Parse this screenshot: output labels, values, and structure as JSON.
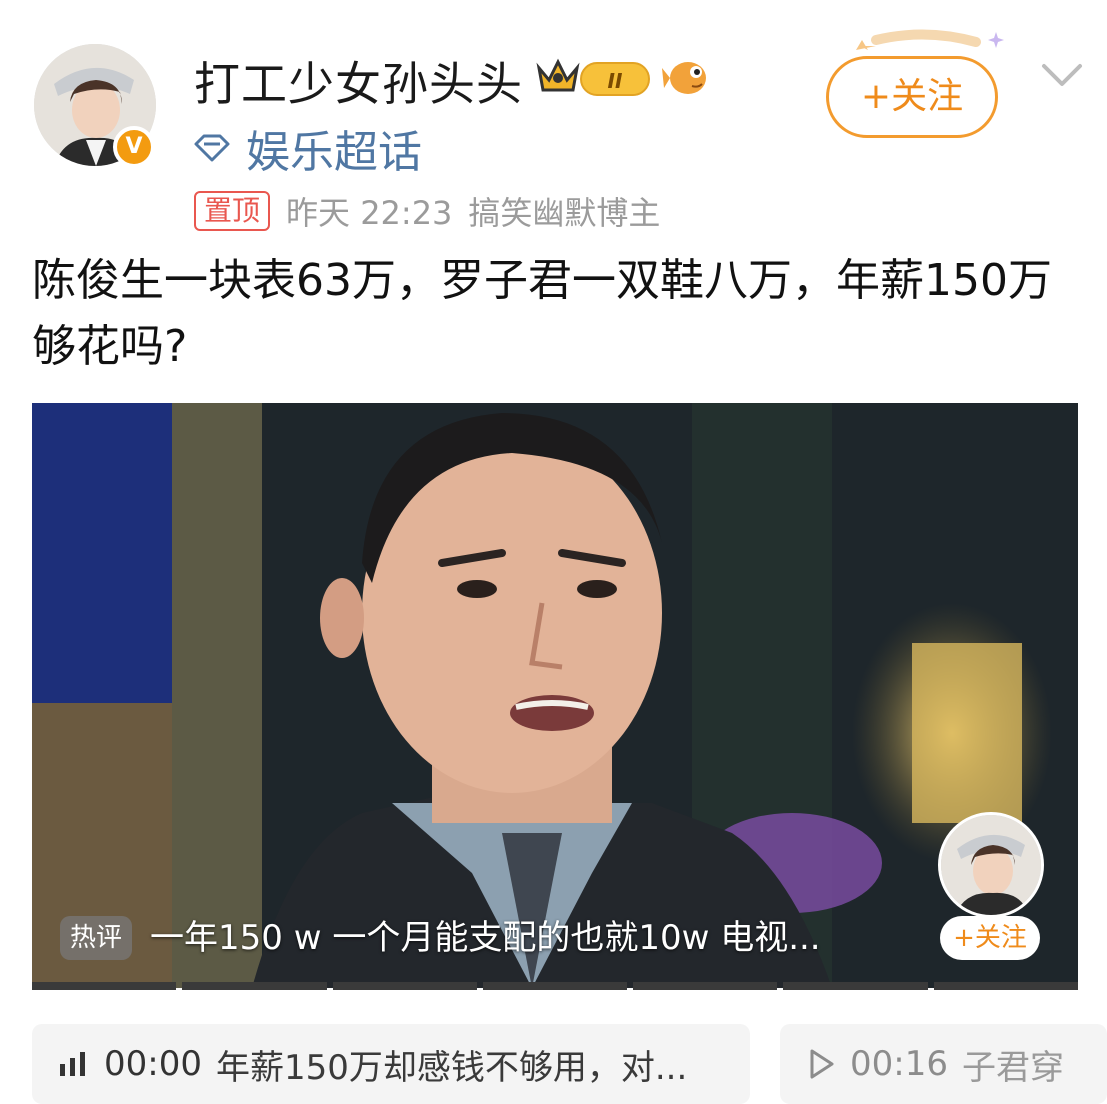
{
  "post": {
    "username": "打工少女孙头头",
    "level_badge": "II",
    "super_topic": "娱乐超话",
    "pin_tag": "置顶",
    "timestamp": "昨天 22:23",
    "author_tag": "搞笑幽默博主",
    "follow_label": "+关注",
    "text": "陈俊生一块表63万，罗子君一双鞋八万，年薪150万够花吗?"
  },
  "video": {
    "hot_comment_tag": "热评",
    "hot_comment": "一年150 w 一个月能支配的也就10w  电视...",
    "mini_follow_label": "+关注"
  },
  "chapters": [
    {
      "time": "00:00",
      "title": "年薪150万却感钱不够用，对..."
    },
    {
      "time": "00:16",
      "title": "子君穿"
    }
  ],
  "colors": {
    "accent": "#ef8b1b",
    "verified": "#f39b10",
    "link": "#5077a3",
    "pin": "#e9574f"
  },
  "icons": [
    "verified-v-icon",
    "crown-icon",
    "fish-emoji-icon",
    "diamond-icon",
    "chevron-down-icon",
    "equalizer-icon",
    "play-outline-icon"
  ]
}
